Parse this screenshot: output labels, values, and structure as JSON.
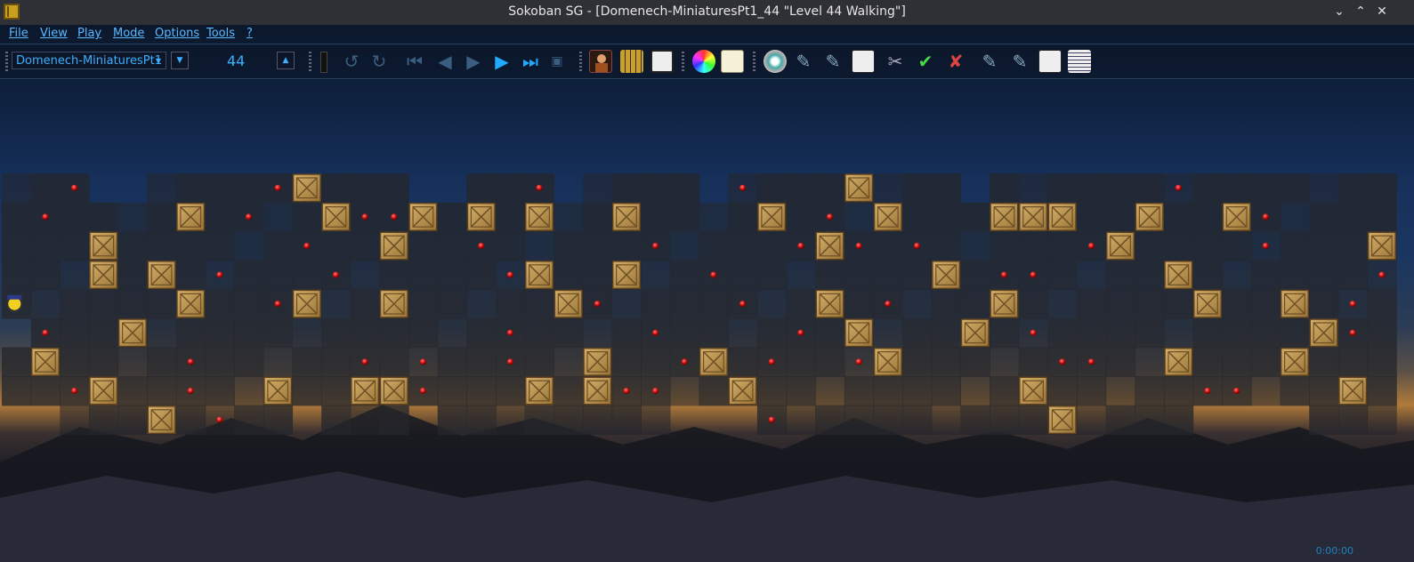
{
  "window": {
    "title": "Sokoban SG - [Domenech-MiniaturesPt1_44 \"Level 44 Walking\"]",
    "minimize_glyph": "⌄",
    "maximize_glyph": "⌃",
    "close_glyph": "✕"
  },
  "menu": [
    "File",
    "View",
    "Play",
    "Mode",
    "Options",
    "Tools",
    "?"
  ],
  "toolbar": {
    "collection": "Domenech-MiniaturesPt1",
    "level_number": "44",
    "dropdown_glyph": "▼",
    "up_glyph": "▲",
    "undo_glyph": "↺",
    "redo_glyph": "↻",
    "first_glyph": "⏮",
    "prev_glyph": "◀",
    "play_glyph": "▶",
    "play2_glyph": "▶",
    "last_glyph": "⏭",
    "icons": [
      "player-skin-icon",
      "grid-icon",
      "pages-icon",
      "color-wheel-icon",
      "notes-icon",
      "target-icon",
      "solver-icon",
      "solver-opt-icon",
      "edit-icon",
      "tools-icon",
      "check-icon",
      "error-icon",
      "export-icon",
      "export-opt-icon",
      "copy-icon",
      "document-icon"
    ]
  },
  "status": "0:00:00",
  "colors": {
    "accent": "#3ab0ff",
    "floor": "#25272c",
    "crate": "#b08d4a",
    "goal": "#cc1a1a"
  }
}
